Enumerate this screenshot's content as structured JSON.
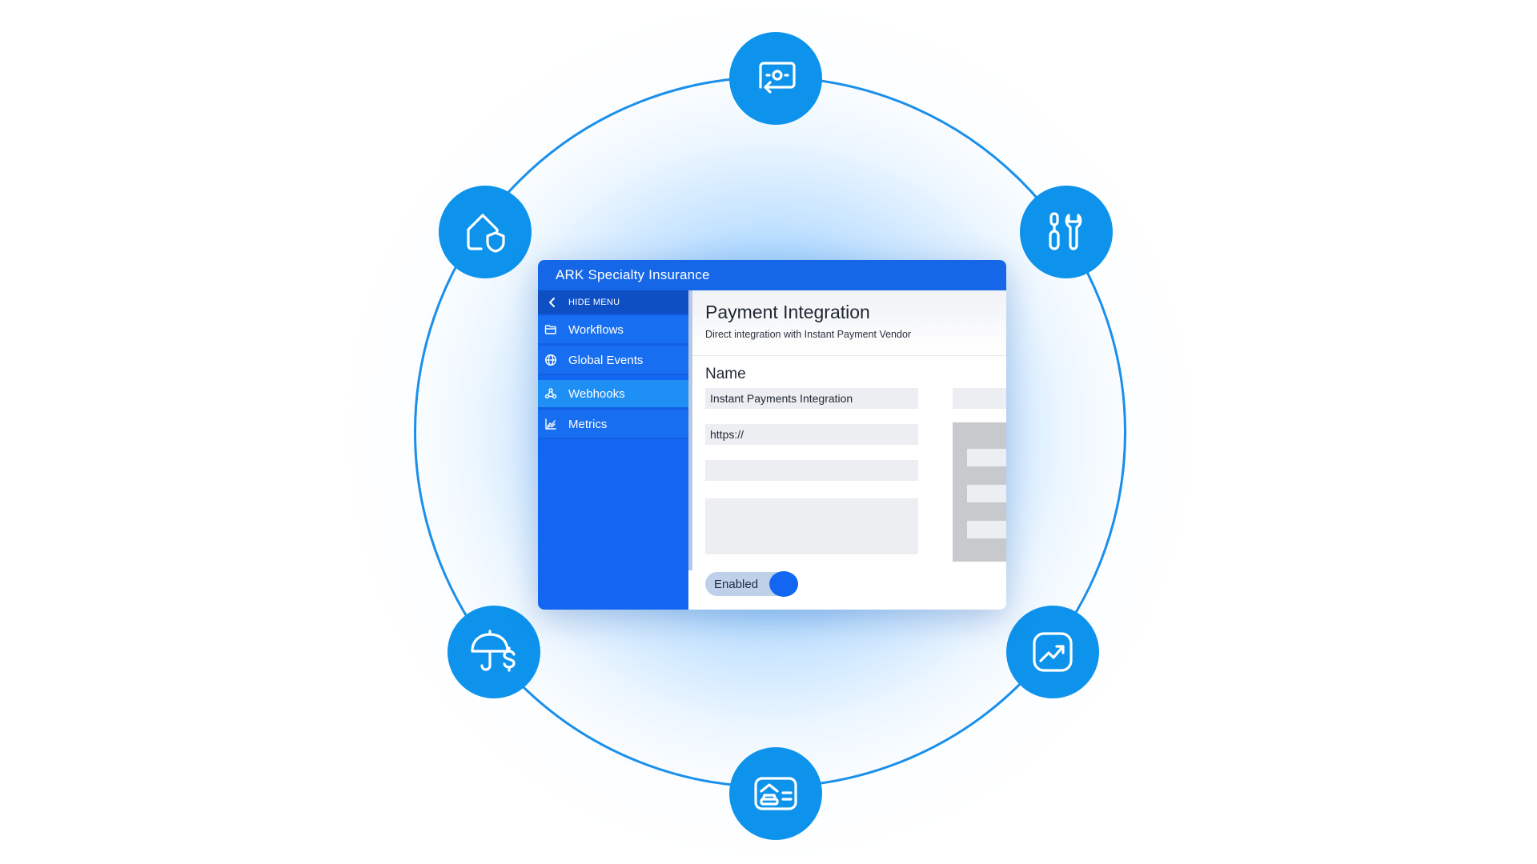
{
  "app": {
    "title": "ARK Specialty Insurance"
  },
  "sidebar": {
    "hide_menu_label": "HIDE MENU",
    "items": [
      {
        "label": "Workflows",
        "icon": "folder-icon",
        "active": false
      },
      {
        "label": "Global Events",
        "icon": "globe-icon",
        "active": false
      },
      {
        "label": "Webhooks",
        "icon": "webhook-icon",
        "active": true
      },
      {
        "label": "Metrics",
        "icon": "chart-icon",
        "active": false
      }
    ]
  },
  "main": {
    "title": "Payment Integration",
    "subtitle": "Direct integration with Instant Payment Vendor",
    "section_label": "Name",
    "fields": {
      "name_value": "Instant Payments Integration",
      "url_value": "https://"
    },
    "toggle": {
      "label": "Enabled",
      "on": true
    }
  },
  "badges": [
    "money-transfer-icon",
    "home-shield-icon",
    "tools-icon",
    "umbrella-dollar-icon",
    "growth-chart-icon",
    "car-card-icon"
  ],
  "colors": {
    "accent": "#1266f1",
    "badge": "#0d93ec",
    "ring": "#1a8fea"
  }
}
